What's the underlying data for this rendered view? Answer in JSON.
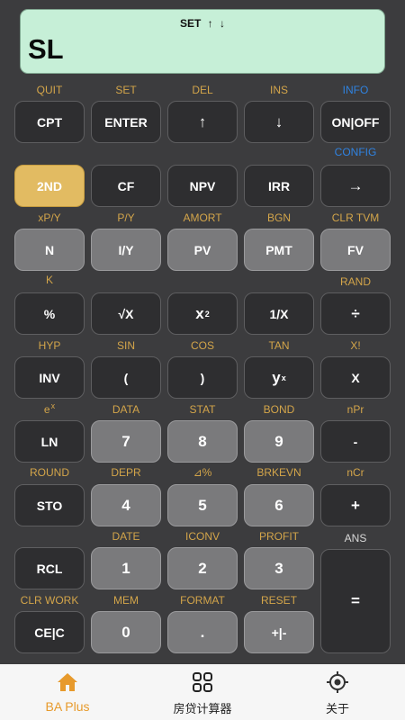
{
  "display": {
    "indicators": [
      "SET",
      "↑",
      "↓"
    ],
    "value": "SL"
  },
  "keypad": [
    {
      "label": "CPT",
      "second": "QUIT"
    },
    {
      "label": "ENTER",
      "second": "SET"
    },
    {
      "label": "↑",
      "second": "DEL"
    },
    {
      "label": "↓",
      "second": "INS"
    },
    {
      "label": "ON|OFF",
      "second": "INFO",
      "below": "CONFIG"
    },
    {
      "label": "2ND"
    },
    {
      "label": "CF"
    },
    {
      "label": "NPV"
    },
    {
      "label": "IRR"
    },
    {
      "label": "→"
    },
    {
      "label": "N",
      "second": "xP/Y",
      "below": "K"
    },
    {
      "label": "I/Y",
      "second": "P/Y"
    },
    {
      "label": "PV",
      "second": "AMORT"
    },
    {
      "label": "PMT",
      "second": "BGN"
    },
    {
      "label": "FV",
      "second": "CLR TVM",
      "below": "RAND"
    },
    {
      "label": "%"
    },
    {
      "label": "√X"
    },
    {
      "label": "x",
      "sup": "2"
    },
    {
      "label": "1/X"
    },
    {
      "label": "÷"
    },
    {
      "label": "INV",
      "second": "HYP"
    },
    {
      "label": "(",
      "second": "SIN"
    },
    {
      "label": ")",
      "second": "COS"
    },
    {
      "label": "y",
      "sup": "x",
      "second": "TAN"
    },
    {
      "label": "X",
      "second": "X!"
    },
    {
      "label": "LN",
      "second": "e",
      "second_sup": "x"
    },
    {
      "label": "7",
      "second": "DATA"
    },
    {
      "label": "8",
      "second": "STAT"
    },
    {
      "label": "9",
      "second": "BOND"
    },
    {
      "label": "-",
      "second": "nPr"
    },
    {
      "label": "STO",
      "second": "ROUND"
    },
    {
      "label": "4",
      "second": "DEPR"
    },
    {
      "label": "5",
      "second": "⊿%"
    },
    {
      "label": "6",
      "second": "BRKEVN"
    },
    {
      "label": "+",
      "second": "nCr"
    },
    {
      "label": "RCL"
    },
    {
      "label": "1",
      "second": "DATE"
    },
    {
      "label": "2",
      "second": "ICONV"
    },
    {
      "label": "3",
      "second": "PROFIT"
    },
    {
      "label": "=",
      "second": "ANS"
    },
    {
      "label": "CE|C",
      "second": "CLR WORK"
    },
    {
      "label": "0",
      "second": "MEM"
    },
    {
      "label": ".",
      "second": "FORMAT"
    },
    {
      "label": "+|-",
      "second": "RESET"
    }
  ],
  "colors": {
    "second_function": "#d3a54a",
    "info": "#2f82e0",
    "second_key": "#e2bb62",
    "number_key": "#7a7a7c",
    "function_key": "#2e2e30",
    "display": "#c6efd7",
    "active_tab": "#e79a2c"
  },
  "tabs": [
    {
      "label": "BA Plus",
      "icon": "home-icon",
      "active": true
    },
    {
      "label": "房贷计算器",
      "icon": "grid-icon",
      "active": false
    },
    {
      "label": "关于",
      "icon": "target-icon",
      "active": false
    }
  ]
}
